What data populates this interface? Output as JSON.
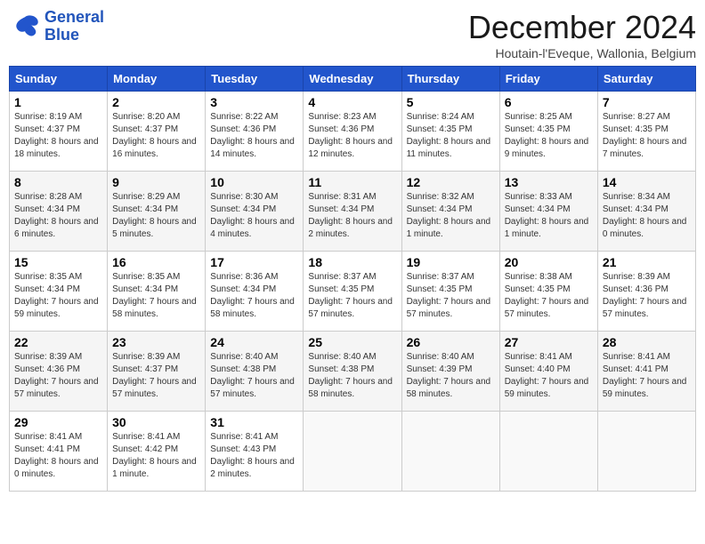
{
  "logo": {
    "line1": "General",
    "line2": "Blue"
  },
  "title": "December 2024",
  "location": "Houtain-l'Eveque, Wallonia, Belgium",
  "days_of_week": [
    "Sunday",
    "Monday",
    "Tuesday",
    "Wednesday",
    "Thursday",
    "Friday",
    "Saturday"
  ],
  "weeks": [
    [
      {
        "day": 1,
        "sunrise": "8:19 AM",
        "sunset": "4:37 PM",
        "daylight": "8 hours and 18 minutes."
      },
      {
        "day": 2,
        "sunrise": "8:20 AM",
        "sunset": "4:37 PM",
        "daylight": "8 hours and 16 minutes."
      },
      {
        "day": 3,
        "sunrise": "8:22 AM",
        "sunset": "4:36 PM",
        "daylight": "8 hours and 14 minutes."
      },
      {
        "day": 4,
        "sunrise": "8:23 AM",
        "sunset": "4:36 PM",
        "daylight": "8 hours and 12 minutes."
      },
      {
        "day": 5,
        "sunrise": "8:24 AM",
        "sunset": "4:35 PM",
        "daylight": "8 hours and 11 minutes."
      },
      {
        "day": 6,
        "sunrise": "8:25 AM",
        "sunset": "4:35 PM",
        "daylight": "8 hours and 9 minutes."
      },
      {
        "day": 7,
        "sunrise": "8:27 AM",
        "sunset": "4:35 PM",
        "daylight": "8 hours and 7 minutes."
      }
    ],
    [
      {
        "day": 8,
        "sunrise": "8:28 AM",
        "sunset": "4:34 PM",
        "daylight": "8 hours and 6 minutes."
      },
      {
        "day": 9,
        "sunrise": "8:29 AM",
        "sunset": "4:34 PM",
        "daylight": "8 hours and 5 minutes."
      },
      {
        "day": 10,
        "sunrise": "8:30 AM",
        "sunset": "4:34 PM",
        "daylight": "8 hours and 4 minutes."
      },
      {
        "day": 11,
        "sunrise": "8:31 AM",
        "sunset": "4:34 PM",
        "daylight": "8 hours and 2 minutes."
      },
      {
        "day": 12,
        "sunrise": "8:32 AM",
        "sunset": "4:34 PM",
        "daylight": "8 hours and 1 minute."
      },
      {
        "day": 13,
        "sunrise": "8:33 AM",
        "sunset": "4:34 PM",
        "daylight": "8 hours and 1 minute."
      },
      {
        "day": 14,
        "sunrise": "8:34 AM",
        "sunset": "4:34 PM",
        "daylight": "8 hours and 0 minutes."
      }
    ],
    [
      {
        "day": 15,
        "sunrise": "8:35 AM",
        "sunset": "4:34 PM",
        "daylight": "7 hours and 59 minutes."
      },
      {
        "day": 16,
        "sunrise": "8:35 AM",
        "sunset": "4:34 PM",
        "daylight": "7 hours and 58 minutes."
      },
      {
        "day": 17,
        "sunrise": "8:36 AM",
        "sunset": "4:34 PM",
        "daylight": "7 hours and 58 minutes."
      },
      {
        "day": 18,
        "sunrise": "8:37 AM",
        "sunset": "4:35 PM",
        "daylight": "7 hours and 57 minutes."
      },
      {
        "day": 19,
        "sunrise": "8:37 AM",
        "sunset": "4:35 PM",
        "daylight": "7 hours and 57 minutes."
      },
      {
        "day": 20,
        "sunrise": "8:38 AM",
        "sunset": "4:35 PM",
        "daylight": "7 hours and 57 minutes."
      },
      {
        "day": 21,
        "sunrise": "8:39 AM",
        "sunset": "4:36 PM",
        "daylight": "7 hours and 57 minutes."
      }
    ],
    [
      {
        "day": 22,
        "sunrise": "8:39 AM",
        "sunset": "4:36 PM",
        "daylight": "7 hours and 57 minutes."
      },
      {
        "day": 23,
        "sunrise": "8:39 AM",
        "sunset": "4:37 PM",
        "daylight": "7 hours and 57 minutes."
      },
      {
        "day": 24,
        "sunrise": "8:40 AM",
        "sunset": "4:38 PM",
        "daylight": "7 hours and 57 minutes."
      },
      {
        "day": 25,
        "sunrise": "8:40 AM",
        "sunset": "4:38 PM",
        "daylight": "7 hours and 58 minutes."
      },
      {
        "day": 26,
        "sunrise": "8:40 AM",
        "sunset": "4:39 PM",
        "daylight": "7 hours and 58 minutes."
      },
      {
        "day": 27,
        "sunrise": "8:41 AM",
        "sunset": "4:40 PM",
        "daylight": "7 hours and 59 minutes."
      },
      {
        "day": 28,
        "sunrise": "8:41 AM",
        "sunset": "4:41 PM",
        "daylight": "7 hours and 59 minutes."
      }
    ],
    [
      {
        "day": 29,
        "sunrise": "8:41 AM",
        "sunset": "4:41 PM",
        "daylight": "8 hours and 0 minutes."
      },
      {
        "day": 30,
        "sunrise": "8:41 AM",
        "sunset": "4:42 PM",
        "daylight": "8 hours and 1 minute."
      },
      {
        "day": 31,
        "sunrise": "8:41 AM",
        "sunset": "4:43 PM",
        "daylight": "8 hours and 2 minutes."
      },
      null,
      null,
      null,
      null
    ]
  ]
}
